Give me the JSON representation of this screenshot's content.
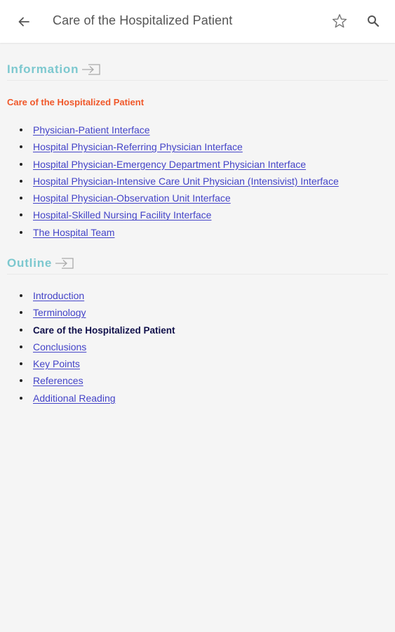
{
  "header": {
    "title": "Care of the Hospitalized Patient",
    "back_icon": "arrow-back-icon",
    "favorite_icon": "star-outline-icon",
    "search_icon": "search-icon"
  },
  "information": {
    "heading": "Information",
    "heading_icon": "open-link-icon",
    "subtitle": "Care of the Hospitalized Patient",
    "links": [
      "Physician-Patient Interface",
      "Hospital Physician-Referring Physician Interface",
      "Hospital Physician-Emergency Department Physician Interface",
      "Hospital Physician-Intensive Care Unit Physician (Intensivist) Interface",
      "Hospital Physician-Observation Unit Interface",
      "Hospital-Skilled Nursing Facility Interface",
      "The Hospital Team"
    ]
  },
  "outline": {
    "heading": "Outline",
    "heading_icon": "open-link-icon",
    "items": [
      "Introduction",
      "Terminology",
      "Care of the Hospitalized Patient",
      "Conclusions",
      "Key Points",
      "References",
      "Additional Reading"
    ],
    "current": "Care of the Hospitalized Patient"
  },
  "colors": {
    "heading": "#7cc8cf",
    "subtitle": "#f0582a",
    "link": "#4343c8",
    "current": "#10104a",
    "background": "#f5f5f5"
  }
}
